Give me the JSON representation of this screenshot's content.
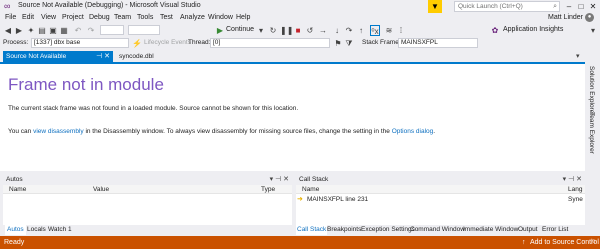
{
  "window": {
    "title": "Source Not Available (Debugging) - Microsoft Visual Studio",
    "quick_launch_placeholder": "Quick Launch (Ctrl+Q)",
    "user": "Matt Linder"
  },
  "menu": [
    "File",
    "Edit",
    "View",
    "Project",
    "Debug",
    "Team",
    "Tools",
    "Test",
    "Analyze",
    "Window",
    "Help"
  ],
  "toolbar": {
    "continue_label": "Continue",
    "stack_frame_label": "Stack Frame:",
    "stack_frame_value": "MAINSXFPL",
    "app_insights": "Application Insights"
  },
  "toolbar2": {
    "process_label": "Process:",
    "process_value": "[1337] dbx base",
    "lifecycle": "Lifecycle Events",
    "thread_label": "Thread:",
    "thread_value": "[0]"
  },
  "tabs": {
    "active": "Source Not Available",
    "inactive": "syncode.dbl"
  },
  "editor": {
    "heading": "Frame not in module",
    "message": "The current stack frame was not found in a loaded module. Source cannot be shown for this location.",
    "disasm_prefix": "You can ",
    "disasm_link": "view disassembly",
    "disasm_mid": " in the Disassembly window. To always view disassembly for missing source files, change the setting in the ",
    "options_link": "Options dialog",
    "disasm_suffix": "."
  },
  "side_tabs": [
    "Solution Explorer",
    "Team Explorer"
  ],
  "autos": {
    "title": "Autos",
    "columns": [
      "Name",
      "Value",
      "Type"
    ],
    "tabs": [
      "Autos",
      "Locals",
      "Watch 1"
    ]
  },
  "callstack": {
    "title": "Call Stack",
    "columns": [
      "Name",
      "Lang"
    ],
    "rows": [
      {
        "name": "MAINSXFPL line 231",
        "lang": "Syne"
      }
    ],
    "tabs": [
      "Call Stack",
      "Breakpoints",
      "Exception Settings",
      "Command Window",
      "Immediate Window",
      "Output",
      "Error List"
    ]
  },
  "status": {
    "left": "Ready",
    "right": "Add to Source Control"
  },
  "colors": {
    "accent": "#007acc",
    "status_bar": "#ca5100",
    "heading": "#7e57c2",
    "link": "#0e70c0"
  }
}
